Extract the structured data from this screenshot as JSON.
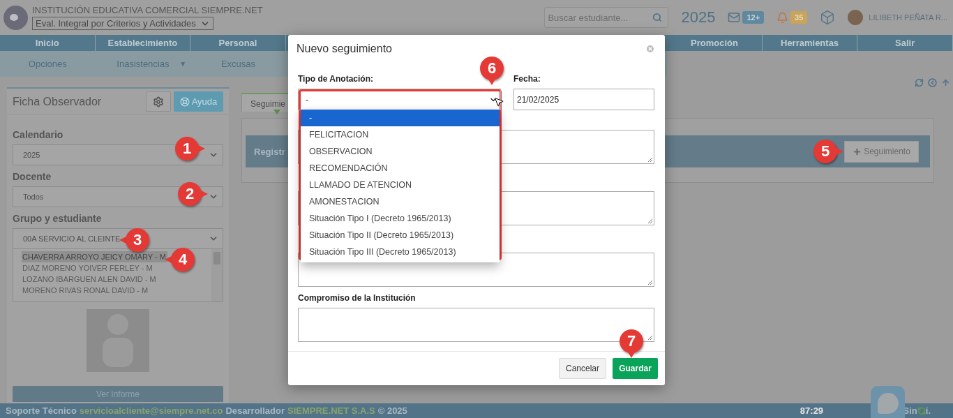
{
  "header": {
    "institution": "INSTITUCIÓN EDUCATIVA COMERCIAL SIEMPRE.NET",
    "mode_select": "Eval. Integral por Criterios y Actividades",
    "search": {
      "placeholder": "Buscar estudiante..."
    },
    "year": "2025",
    "messages_badge": "12+",
    "alerts_badge": "35",
    "user": "LILIBETH PEÑATA R..."
  },
  "menu": {
    "left": [
      "Inicio",
      "Establecimiento",
      "Personal"
    ],
    "right": [
      "Promoción",
      "Herramientas",
      "Salir"
    ]
  },
  "submenu": [
    {
      "label": "Opciones"
    },
    {
      "label": "Inasistencias",
      "caret": "▼"
    },
    {
      "label": "Excusas"
    }
  ],
  "sidebar": {
    "title": "Ficha Observador",
    "help_button": "Ayuda",
    "filters": [
      {
        "label": "Calendario",
        "value": "2025"
      },
      {
        "label": "Docente",
        "value": "Todos"
      },
      {
        "label": "Grupo y estudiante",
        "value": "00A SERVICIO AL CLEINTE"
      }
    ],
    "students": [
      {
        "name": "CHAVERRA ARROYO JEICY OMARY - M",
        "selected": true
      },
      {
        "name": "DIAZ MORENO YOIVER FERLEY - M",
        "selected": false
      },
      {
        "name": "LOZANO IBARGUEN ALEN DAVID - M",
        "selected": false
      },
      {
        "name": "MORENO RIVAS RONAL DAVID - M",
        "selected": false
      }
    ],
    "report_button": "Ver Informe"
  },
  "main": {
    "tab": "Seguimie",
    "bar_title": "Registr",
    "add_button": "Seguimiento"
  },
  "modal": {
    "title": "Nuevo seguimiento",
    "type_field": {
      "label": "Tipo de Anotación:",
      "value": "-"
    },
    "date_field": {
      "label": "Fecha:",
      "value": "21/02/2025"
    },
    "fields": [
      {
        "kind": "textarea"
      },
      {
        "kind": "textarea"
      },
      {
        "kind": "textarea"
      },
      {
        "kind": "labeled",
        "label": "Compromiso de la Institución"
      }
    ],
    "options": [
      {
        "label": "-",
        "selected": true
      },
      {
        "label": "FELICITACION",
        "selected": false
      },
      {
        "label": "OBSERVACION",
        "selected": false
      },
      {
        "label": "RECOMENDACIÓN",
        "selected": false
      },
      {
        "label": "LLAMADO DE ATENCION",
        "selected": false
      },
      {
        "label": "AMONESTACION",
        "selected": false
      },
      {
        "label": "Situación Tipo I (Decreto 1965/2013)",
        "selected": false
      },
      {
        "label": "Situación Tipo II (Decreto 1965/2013)",
        "selected": false
      },
      {
        "label": "Situación Tipo III (Decreto 1965/2013)",
        "selected": false
      }
    ],
    "cancel_button": "Cancelar",
    "save_button": "Guardar"
  },
  "callouts": [
    "1",
    "2",
    "3",
    "4",
    "5",
    "6",
    "7"
  ],
  "footer": {
    "support_label": "Soporte Técnico",
    "support_email": "servicioalcliente@siempre.net.co",
    "developer_label": "Desarrollador",
    "developer": "SIEMPRE.NET S.A.S",
    "copyright": "© 2025",
    "timer": "87:29",
    "logo_left": "Sin",
    "logo_right": "i."
  }
}
